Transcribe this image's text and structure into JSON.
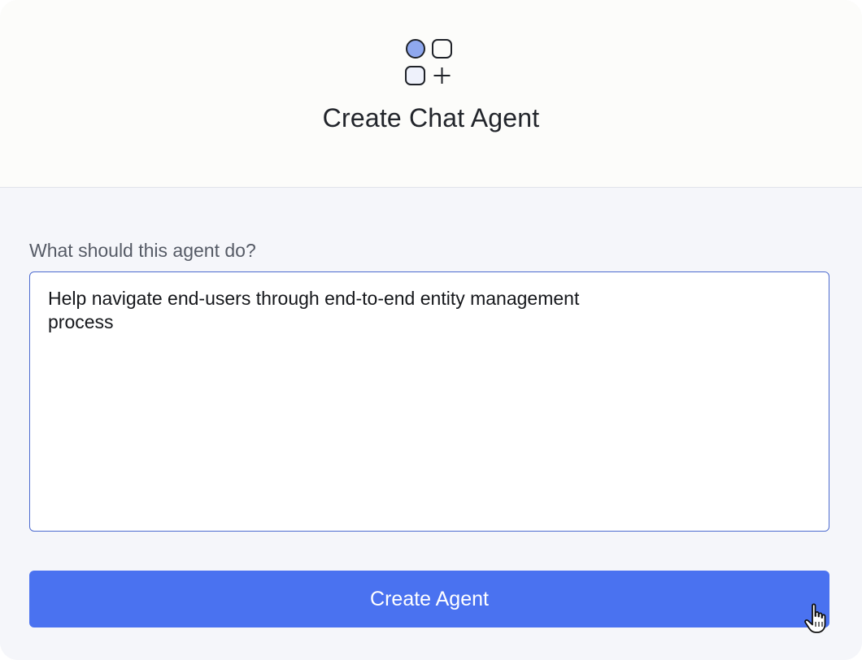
{
  "header": {
    "title": "Create Chat Agent",
    "icon": "agent-grid-icon"
  },
  "form": {
    "prompt_label": "What should this agent do?",
    "prompt_value": "Help navigate end-users through end-to-end entity management\nprocess",
    "submit_label": "Create Agent"
  },
  "colors": {
    "accent": "#4a72f0",
    "input_border": "#4d6bcf",
    "icon_fill": "#8fa8ef",
    "icon_fill_light": "#eef1fb",
    "header_bg": "#fcfcfa",
    "body_bg": "#f5f6fa"
  },
  "cursor": {
    "type": "hand-pointer-icon"
  }
}
